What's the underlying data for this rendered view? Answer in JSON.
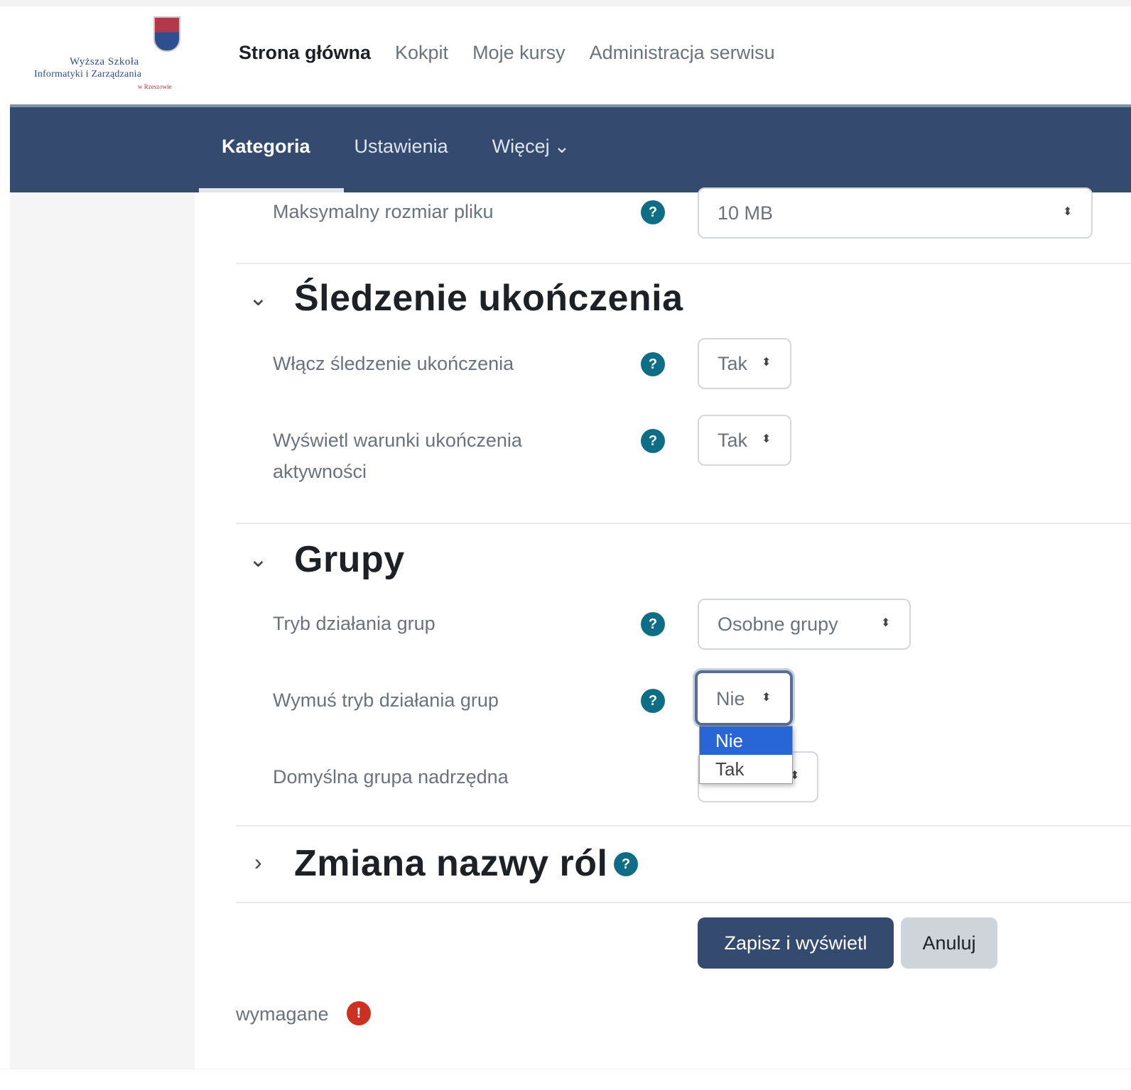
{
  "header": {
    "logo": {
      "line1": "Wyższa Szkoła",
      "line2": "Informatyki i Zarządzania",
      "line3": "w Rzeszowie",
      "icon": "crest-shield"
    },
    "nav": [
      "Strona główna",
      "Kokpit",
      "Moje kursy",
      "Administracja serwisu"
    ]
  },
  "secondary_nav": {
    "items": [
      "Kategoria",
      "Ustawienia",
      "Więcej"
    ],
    "more_chevron": "⌄"
  },
  "form": {
    "max_file_size": {
      "label": "Maksymalny rozmiar pliku",
      "value": "10 MB"
    },
    "completion_section": {
      "title": "Śledzenie ukończenia",
      "enable": {
        "label": "Włącz śledzenie ukończenia",
        "value": "Tak"
      },
      "show_conditions": {
        "label_line1": "Wyświetl warunki ukończenia",
        "label_line2": "aktywności",
        "value": "Tak"
      }
    },
    "groups_section": {
      "title": "Grupy",
      "group_mode": {
        "label": "Tryb działania grup",
        "value": "Osobne grupy"
      },
      "force_group_mode": {
        "label": "Wymuś tryb działania grup",
        "value": "Nie",
        "options": [
          "Nie",
          "Tak"
        ],
        "selected_index": 0
      },
      "default_grouping": {
        "label": "Domyślna grupa nadrzędna"
      }
    },
    "roles_section": {
      "title": "Zmiana nazwy ról"
    }
  },
  "buttons": {
    "save": "Zapisz i wyświetl",
    "cancel": "Anuluj"
  },
  "required_note": "wymagane",
  "icons": {
    "help": "?",
    "required": "!"
  },
  "colors": {
    "navbar": "#344a6e",
    "help_icon": "#0f6e86",
    "required_icon": "#ca3120",
    "dropdown_highlight": "#2865d6"
  }
}
